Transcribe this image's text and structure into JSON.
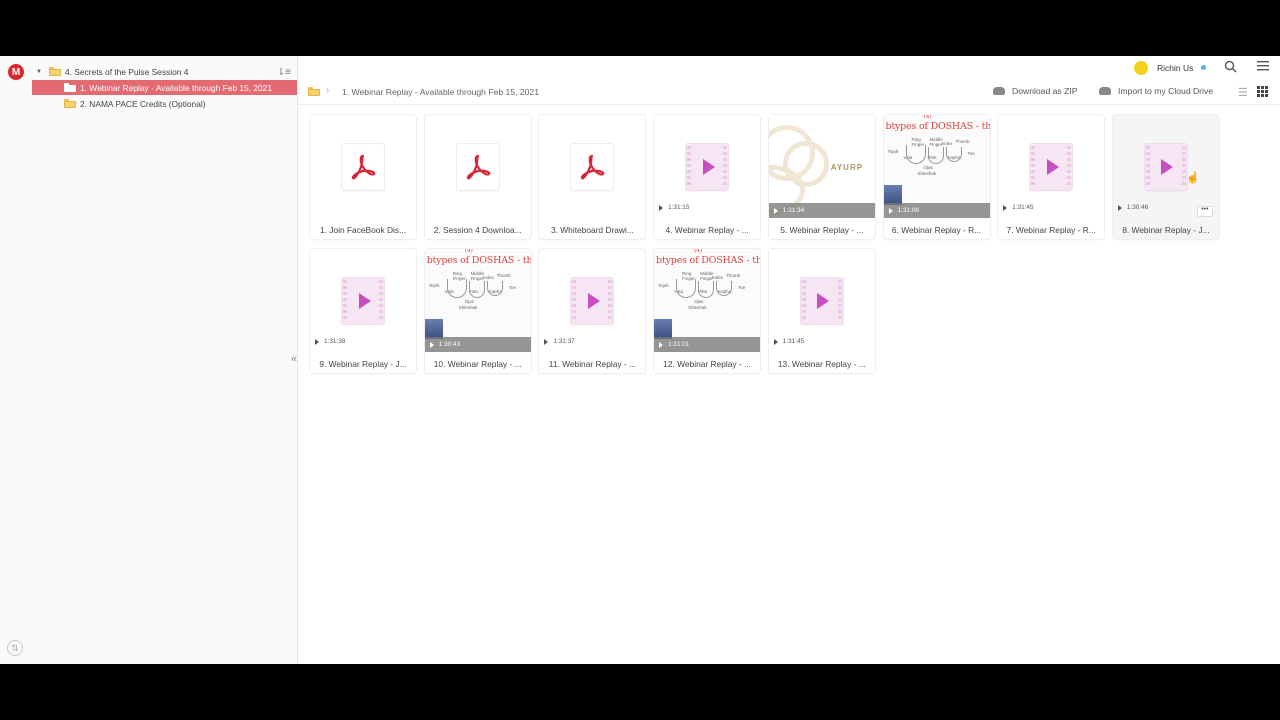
{
  "sidebar": {
    "tree": [
      {
        "label": "4. Secrets of the Pulse Session 4",
        "level": 0,
        "expanded": true,
        "selected": false
      },
      {
        "label": "1. Webinar Replay - Available through Feb 15, 2021",
        "level": 1,
        "selected": true
      },
      {
        "label": "2. NAMA PACE Credits (Optional)",
        "level": 1,
        "selected": false
      }
    ]
  },
  "topbar": {
    "user_name": "Richin Us"
  },
  "toolbar": {
    "breadcrumb": "1. Webinar Replay - Available through Feb 15, 2021",
    "download_zip": "Download as ZIP",
    "import_cloud": "Import to my Cloud Drive"
  },
  "whiteboard": {
    "title": "btypes of DOSHAS - through t",
    "top_word": "(4)",
    "words": [
      "Ring",
      "Finger",
      "Middle",
      "Finger",
      "Index",
      "Thumb",
      "Vata",
      "Pitta",
      "Kapha",
      "Toe",
      "Tejah",
      "Ojas",
      "Shleshak"
    ]
  },
  "ayur_text": "AYURP",
  "files": [
    {
      "name": "1. Join FaceBook Dis...",
      "kind": "pdf",
      "duration": ""
    },
    {
      "name": "2. Session 4 Downloa...",
      "kind": "pdf",
      "duration": ""
    },
    {
      "name": "3. Whiteboard Drawi...",
      "kind": "pdf",
      "duration": ""
    },
    {
      "name": "4. Webinar Replay - ...",
      "kind": "video",
      "duration": "1:31:15"
    },
    {
      "name": "5. Webinar Replay - ...",
      "kind": "ayurveda",
      "duration": "1:31:34"
    },
    {
      "name": "6. Webinar Replay - R...",
      "kind": "whiteboard",
      "duration": "1:31:08"
    },
    {
      "name": "7. Webinar Replay - R...",
      "kind": "video",
      "duration": "1:31:45"
    },
    {
      "name": "8. Webinar Replay - J...",
      "kind": "video",
      "duration": "1:30:46",
      "hover": true
    },
    {
      "name": "9. Webinar Replay - J...",
      "kind": "video",
      "duration": "1:31:38"
    },
    {
      "name": "10. Webinar Replay - ...",
      "kind": "whiteboard",
      "duration": "1:30:43"
    },
    {
      "name": "11. Webinar Replay - ...",
      "kind": "video",
      "duration": "1:31:37"
    },
    {
      "name": "12. Webinar Replay - ...",
      "kind": "whiteboard",
      "duration": "1:31:01"
    },
    {
      "name": "13. Webinar Replay - ...",
      "kind": "video",
      "duration": "1:31:45"
    }
  ],
  "colors": {
    "accent": "#e36a72",
    "brand": "#d9272e",
    "pdf": "#d8263a",
    "video": "#c94fc0"
  },
  "icons": {
    "pdf": "acrobat-pdf-icon",
    "video": "video-play-icon",
    "more": "more-options-icon"
  }
}
